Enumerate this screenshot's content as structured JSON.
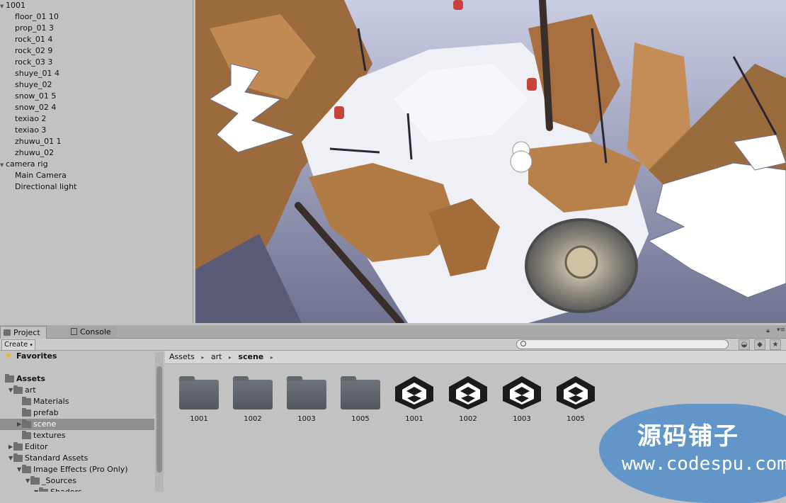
{
  "hierarchy": {
    "items": [
      {
        "label": "1001",
        "indent": 0,
        "fold": true
      },
      {
        "label": "floor_01 10",
        "indent": 1
      },
      {
        "label": "prop_01 3",
        "indent": 1
      },
      {
        "label": "rock_01 4",
        "indent": 1
      },
      {
        "label": "rock_02 9",
        "indent": 1
      },
      {
        "label": "rock_03 3",
        "indent": 1
      },
      {
        "label": "shuye_01 4",
        "indent": 1
      },
      {
        "label": "shuye_02",
        "indent": 1
      },
      {
        "label": "snow_01 5",
        "indent": 1
      },
      {
        "label": "snow_02 4",
        "indent": 1
      },
      {
        "label": "texiao 2",
        "indent": 1
      },
      {
        "label": "texiao 3",
        "indent": 1
      },
      {
        "label": "zhuwu_01 1",
        "indent": 1
      },
      {
        "label": "zhuwu_02",
        "indent": 1
      },
      {
        "label": "camera rig",
        "indent": 0,
        "fold": true
      },
      {
        "label": "Main Camera",
        "indent": 1
      },
      {
        "label": "Directional light",
        "indent": 1
      }
    ]
  },
  "project": {
    "tabs": [
      {
        "label": "Project",
        "active": true
      },
      {
        "label": "Console",
        "active": false
      }
    ],
    "toolbar": {
      "create_label": "Create"
    },
    "favorites_label": "Favorites",
    "tree": [
      {
        "label": "Assets",
        "bold": true
      },
      {
        "label": "art",
        "expanded": true
      },
      {
        "label": "Materials"
      },
      {
        "label": "prefab"
      },
      {
        "label": "scene",
        "selected": true
      },
      {
        "label": "textures"
      },
      {
        "label": "Editor"
      },
      {
        "label": "Standard Assets",
        "expanded": true
      },
      {
        "label": "Image Effects (Pro Only)",
        "expanded": true
      },
      {
        "label": "_Sources",
        "expanded": true
      },
      {
        "label": "Shaders"
      }
    ],
    "breadcrumb": [
      "Assets",
      "art",
      "scene"
    ],
    "assets": [
      {
        "label": "1001",
        "kind": "folder"
      },
      {
        "label": "1002",
        "kind": "folder"
      },
      {
        "label": "1003",
        "kind": "folder"
      },
      {
        "label": "1005",
        "kind": "folder"
      },
      {
        "label": "1001",
        "kind": "unity-scene"
      },
      {
        "label": "1002",
        "kind": "unity-scene"
      },
      {
        "label": "1003",
        "kind": "unity-scene"
      },
      {
        "label": "1005",
        "kind": "unity-scene"
      }
    ]
  },
  "watermark": {
    "line1": "源码铺子",
    "line2": "www.codespu.com"
  },
  "colors": {
    "panel": "#c2c2c2",
    "selection": "#8f8f8f",
    "snow": "#eef0f6",
    "rock": "#b07a45"
  }
}
